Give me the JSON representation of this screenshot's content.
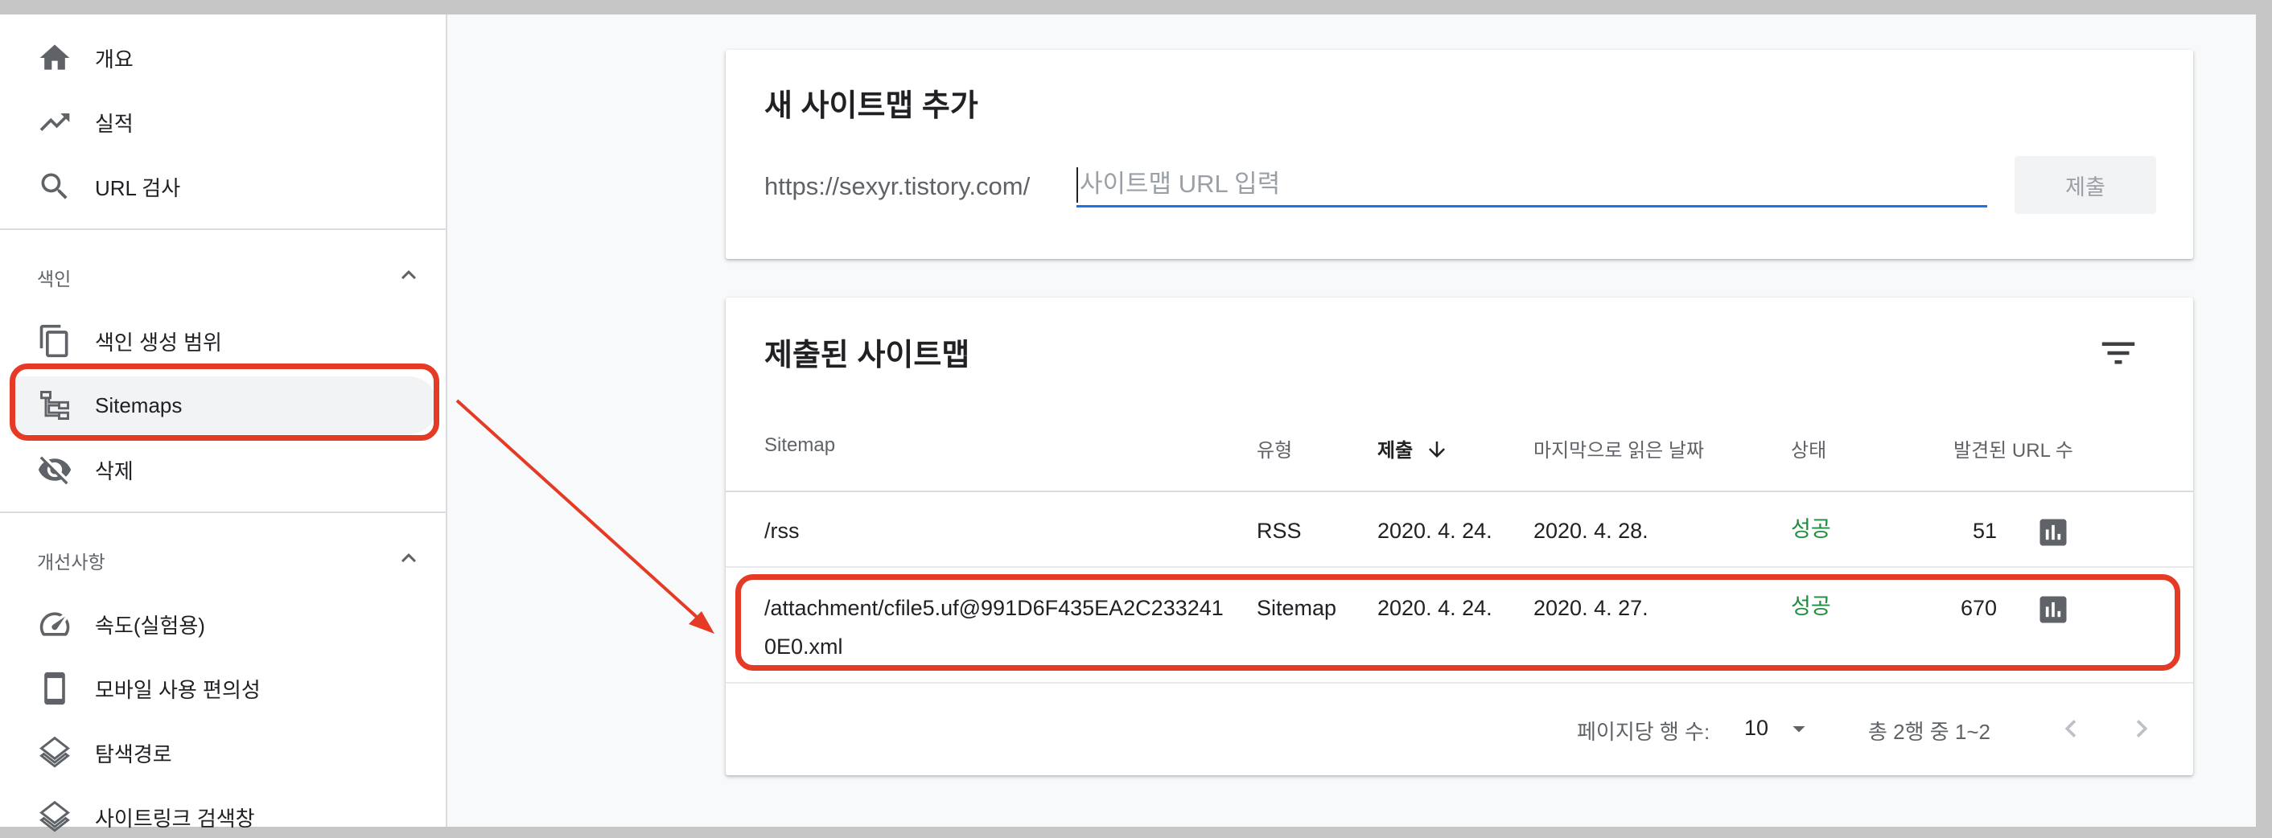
{
  "sidebar": {
    "top_items": [
      {
        "label": "개요",
        "icon": "home-icon"
      },
      {
        "label": "실적",
        "icon": "trending-up-icon"
      },
      {
        "label": "URL 검사",
        "icon": "search-icon"
      }
    ],
    "index_section": {
      "title": "색인",
      "items": [
        {
          "label": "색인 생성 범위",
          "icon": "copy-icon"
        },
        {
          "label": "Sitemaps",
          "icon": "sitemap-icon",
          "active": true
        },
        {
          "label": "삭제",
          "icon": "visibility-off-icon"
        }
      ]
    },
    "enhancements_section": {
      "title": "개선사항",
      "items": [
        {
          "label": "속도(실험용)",
          "icon": "speed-icon"
        },
        {
          "label": "모바일 사용 편의성",
          "icon": "smartphone-icon"
        },
        {
          "label": "탐색경로",
          "icon": "layers-icon"
        },
        {
          "label": "사이트링크 검색창",
          "icon": "layers-icon"
        }
      ]
    }
  },
  "add_sitemap": {
    "title": "새 사이트맵 추가",
    "url_prefix": "https://sexyr.tistory.com/",
    "input_value": "",
    "input_placeholder": "사이트맵 URL 입력",
    "submit_label": "제출"
  },
  "submitted": {
    "title": "제출된 사이트맵",
    "columns": [
      "Sitemap",
      "유형",
      "제출",
      "마지막으로 읽은 날짜",
      "상태",
      "발견된 URL 수"
    ],
    "sorted_column": "제출",
    "rows": [
      {
        "sitemap": "/rss",
        "type": "RSS",
        "submitted": "2020. 4. 24.",
        "last_read": "2020. 4. 28.",
        "status": "성공",
        "urls": "51"
      },
      {
        "sitemap": "/attachment/cfile5.uf@991D6F435EA2C2332410E0.xml",
        "type": "Sitemap",
        "submitted": "2020. 4. 24.",
        "last_read": "2020. 4. 27.",
        "status": "성공",
        "urls": "670"
      }
    ],
    "pagination": {
      "rows_per_page_label": "페이지당 행 수:",
      "rows_per_page": "10",
      "range": "총 2행 중 1~2"
    }
  },
  "colors": {
    "accent": "#1a73e8",
    "success": "#1e8e3e",
    "highlight": "#e53a25"
  }
}
